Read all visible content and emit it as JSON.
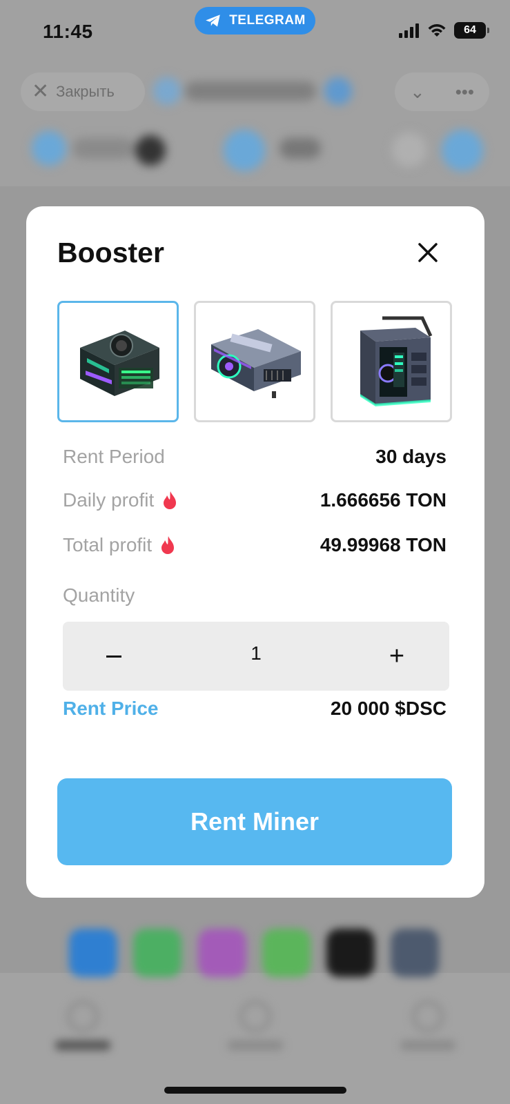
{
  "status_bar": {
    "time": "11:45",
    "telegram_label": "TELEGRAM",
    "battery": "64"
  },
  "app_bar": {
    "close_label": "Закрыть"
  },
  "modal": {
    "title": "Booster",
    "thumbnails": [
      {
        "name": "miner-1",
        "selected": true
      },
      {
        "name": "miner-2",
        "selected": false
      },
      {
        "name": "miner-3",
        "selected": false
      }
    ],
    "rent_period": {
      "label": "Rent Period",
      "value": "30 days"
    },
    "daily_profit": {
      "label": "Daily profit",
      "value": "1.666656 TON"
    },
    "total_profit": {
      "label": "Total profit",
      "value": "49.99968 TON"
    },
    "quantity": {
      "label": "Quantity",
      "value": "1",
      "minus": "−",
      "plus": "+"
    },
    "rent_price": {
      "label": "Rent Price",
      "value": "20 000 $DSC"
    },
    "rent_button": "Rent Miner"
  },
  "colors": {
    "accent": "#57b8f0",
    "telegram": "#2f8ee8",
    "selected_border": "#5bb6ea",
    "flame": "#f0384f",
    "overlay": "#9a9a9a"
  }
}
